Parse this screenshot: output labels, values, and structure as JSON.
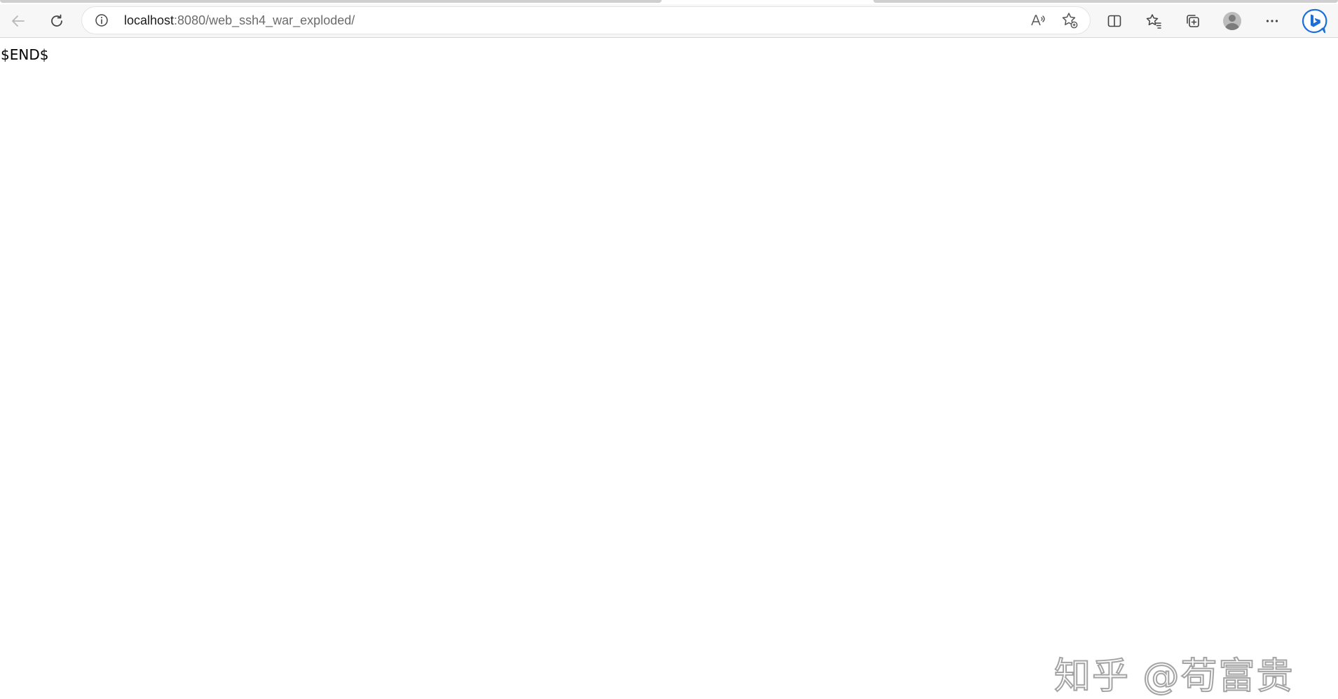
{
  "browser": {
    "url_host": "localhost",
    "url_path": ":8080/web_ssh4_war_exploded/",
    "colors": {
      "toolbar_bg": "#f7f7f7",
      "icon": "#444444",
      "bing_blue": "#1d6fd8"
    },
    "icons": {
      "back": "arrow-left-icon",
      "refresh": "refresh-icon",
      "info": "info-icon",
      "read_aloud": "read-aloud-icon",
      "favorite": "favorite-add-icon",
      "split": "split-screen-icon",
      "favorites": "favorites-icon",
      "collections": "collections-icon",
      "profile": "avatar",
      "more": "more-icon",
      "bing": "bing-icon"
    }
  },
  "page": {
    "body_text": "$END$"
  },
  "watermark": {
    "text": "知乎 @苟富贵"
  }
}
